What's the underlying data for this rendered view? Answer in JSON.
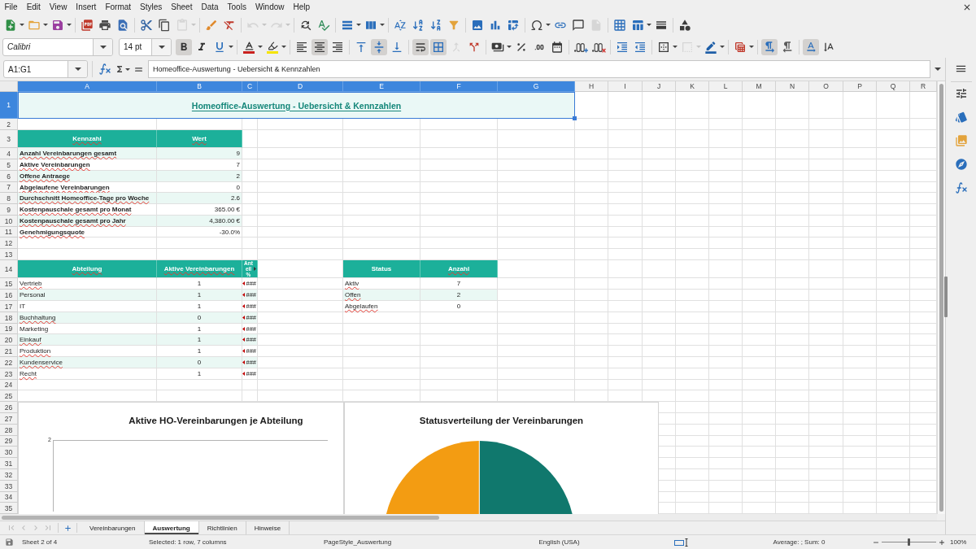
{
  "menu_bar": {
    "items": [
      "File",
      "Edit",
      "View",
      "Insert",
      "Format",
      "Styles",
      "Sheet",
      "Data",
      "Tools",
      "Window",
      "Help"
    ]
  },
  "standard_toolbar": {
    "groups": [
      [
        {
          "kind": "new",
          "menu": true,
          "disabled": false
        },
        {
          "kind": "open",
          "menu": true,
          "disabled": false
        },
        {
          "kind": "save",
          "menu": true,
          "disabled": false
        }
      ],
      [
        {
          "kind": "pdf",
          "menu": false,
          "disabled": false
        },
        {
          "kind": "print",
          "menu": false,
          "disabled": false
        },
        {
          "kind": "preview",
          "menu": false,
          "disabled": false
        }
      ],
      [
        {
          "kind": "cut",
          "menu": false,
          "disabled": false
        },
        {
          "kind": "copy",
          "menu": false,
          "disabled": false
        },
        {
          "kind": "paste",
          "menu": true,
          "disabled": true
        }
      ],
      [
        {
          "kind": "clone",
          "menu": false,
          "disabled": false
        },
        {
          "kind": "clear",
          "menu": false,
          "disabled": false
        }
      ],
      [
        {
          "kind": "undo",
          "menu": true,
          "disabled": true
        },
        {
          "kind": "redo",
          "menu": true,
          "disabled": true
        }
      ],
      [
        {
          "kind": "find",
          "menu": false,
          "disabled": false
        },
        {
          "kind": "spelling",
          "menu": false,
          "disabled": false
        }
      ],
      [
        {
          "kind": "row",
          "menu": true,
          "disabled": false
        },
        {
          "kind": "column",
          "menu": true,
          "disabled": false
        }
      ],
      [
        {
          "kind": "sort",
          "menu": false,
          "disabled": false
        },
        {
          "kind": "ascending",
          "menu": false,
          "disabled": false
        },
        {
          "kind": "descending",
          "menu": false,
          "disabled": false
        },
        {
          "kind": "autofilter",
          "menu": false,
          "disabled": false
        }
      ],
      [
        {
          "kind": "image",
          "menu": false,
          "disabled": false
        },
        {
          "kind": "chart",
          "menu": false,
          "disabled": false
        },
        {
          "kind": "pivot",
          "menu": false,
          "disabled": false
        }
      ],
      [
        {
          "kind": "special",
          "menu": true,
          "disabled": false
        },
        {
          "kind": "hyperlink",
          "menu": false,
          "disabled": false
        },
        {
          "kind": "comment",
          "menu": false,
          "disabled": false
        },
        {
          "kind": "headers",
          "menu": false,
          "disabled": true
        }
      ],
      [
        {
          "kind": "printarea",
          "menu": false,
          "disabled": false
        },
        {
          "kind": "freeze",
          "menu": true,
          "disabled": false
        },
        {
          "kind": "split",
          "menu": false,
          "disabled": false
        }
      ],
      [
        {
          "kind": "draw",
          "menu": false,
          "disabled": false
        }
      ]
    ]
  },
  "formatting_toolbar": {
    "font_name": "Calibri",
    "font_size": "14 pt",
    "groups": [
      [
        {
          "kind": "bold",
          "active": true,
          "menu": false,
          "disabled": false
        },
        {
          "kind": "italic",
          "active": false,
          "menu": false,
          "disabled": false
        },
        {
          "kind": "underline",
          "active": false,
          "menu": true,
          "disabled": false
        }
      ],
      [
        {
          "kind": "fontcolor",
          "active": false,
          "menu": true,
          "disabled": false
        },
        {
          "kind": "highlight",
          "active": false,
          "menu": true,
          "disabled": false
        }
      ],
      [
        {
          "kind": "alignleft",
          "active": false,
          "menu": false,
          "disabled": false
        },
        {
          "kind": "aligncenter",
          "active": true,
          "menu": false,
          "disabled": false
        },
        {
          "kind": "alignright",
          "active": false,
          "menu": false,
          "disabled": false
        }
      ],
      [
        {
          "kind": "aligntop",
          "active": false,
          "menu": false,
          "disabled": false
        },
        {
          "kind": "alignmiddle",
          "active": true,
          "menu": false,
          "disabled": false
        },
        {
          "kind": "alignbottom",
          "active": false,
          "menu": false,
          "disabled": false
        }
      ],
      [
        {
          "kind": "wrap",
          "active": true,
          "menu": false,
          "disabled": false
        },
        {
          "kind": "mergecenter",
          "active": true,
          "menu": false,
          "disabled": false
        },
        {
          "kind": "merge",
          "active": false,
          "menu": false,
          "disabled": true
        },
        {
          "kind": "unmerge",
          "active": false,
          "menu": false,
          "disabled": false
        }
      ],
      [
        {
          "kind": "currency",
          "active": false,
          "menu": true,
          "disabled": false
        },
        {
          "kind": "percent",
          "active": false,
          "menu": false,
          "disabled": false
        },
        {
          "kind": "number",
          "active": false,
          "menu": false,
          "disabled": false
        },
        {
          "kind": "date",
          "active": false,
          "menu": false,
          "disabled": false
        }
      ],
      [
        {
          "kind": "adddecimal",
          "active": false,
          "menu": false,
          "disabled": false
        },
        {
          "kind": "deletedecimal",
          "active": false,
          "menu": false,
          "disabled": false
        }
      ],
      [
        {
          "kind": "indent",
          "active": false,
          "menu": false,
          "disabled": false
        },
        {
          "kind": "outdent",
          "active": false,
          "menu": false,
          "disabled": false
        }
      ],
      [
        {
          "kind": "borders",
          "active": false,
          "menu": true,
          "disabled": false
        },
        {
          "kind": "borderstyle",
          "active": false,
          "menu": true,
          "disabled": true
        },
        {
          "kind": "bordercolor",
          "active": false,
          "menu": true,
          "disabled": false
        }
      ],
      [
        {
          "kind": "conditional",
          "active": false,
          "menu": true,
          "disabled": false
        }
      ],
      [
        {
          "kind": "ltr",
          "active": true,
          "menu": false,
          "disabled": false
        },
        {
          "kind": "rtl",
          "active": false,
          "menu": false,
          "disabled": false
        }
      ],
      [
        {
          "kind": "texthorizontal",
          "active": true,
          "menu": false,
          "disabled": false
        },
        {
          "kind": "textvertical",
          "active": false,
          "menu": false,
          "disabled": false
        }
      ]
    ]
  },
  "formula_bar": {
    "name_box": "A1:G1",
    "content": "Homeoffice-Auswertung - Uebersicht & Kennzahlen"
  },
  "sheet": {
    "columns": [
      {
        "label": "A",
        "selected": true
      },
      {
        "label": "B",
        "selected": true
      },
      {
        "label": "C",
        "selected": true
      },
      {
        "label": "D",
        "selected": true
      },
      {
        "label": "E",
        "selected": true
      },
      {
        "label": "F",
        "selected": true
      },
      {
        "label": "G",
        "selected": true
      },
      {
        "label": "H",
        "selected": false
      },
      {
        "label": "I",
        "selected": false
      },
      {
        "label": "J",
        "selected": false
      },
      {
        "label": "K",
        "selected": false
      },
      {
        "label": "L",
        "selected": false
      },
      {
        "label": "M",
        "selected": false
      },
      {
        "label": "N",
        "selected": false
      },
      {
        "label": "O",
        "selected": false
      },
      {
        "label": "P",
        "selected": false
      },
      {
        "label": "Q",
        "selected": false
      },
      {
        "label": "R",
        "selected": false
      }
    ],
    "rows": [
      {
        "label": "1",
        "selected": true
      },
      {
        "label": "2",
        "selected": false
      },
      {
        "label": "3",
        "selected": false
      },
      {
        "label": "4",
        "selected": false
      },
      {
        "label": "5",
        "selected": false
      },
      {
        "label": "6",
        "selected": false
      },
      {
        "label": "7",
        "selected": false
      },
      {
        "label": "8",
        "selected": false
      },
      {
        "label": "9",
        "selected": false
      },
      {
        "label": "10",
        "selected": false
      },
      {
        "label": "11",
        "selected": false
      },
      {
        "label": "12",
        "selected": false
      },
      {
        "label": "13",
        "selected": false
      },
      {
        "label": "14",
        "selected": false
      },
      {
        "label": "15",
        "selected": false
      },
      {
        "label": "16",
        "selected": false
      },
      {
        "label": "17",
        "selected": false
      },
      {
        "label": "18",
        "selected": false
      },
      {
        "label": "19",
        "selected": false
      },
      {
        "label": "20",
        "selected": false
      },
      {
        "label": "21",
        "selected": false
      },
      {
        "label": "22",
        "selected": false
      },
      {
        "label": "23",
        "selected": false
      },
      {
        "label": "24",
        "selected": false
      },
      {
        "label": "25",
        "selected": false
      },
      {
        "label": "26",
        "selected": false
      },
      {
        "label": "27",
        "selected": false
      },
      {
        "label": "28",
        "selected": false
      },
      {
        "label": "29",
        "selected": false
      },
      {
        "label": "30",
        "selected": false
      },
      {
        "label": "31",
        "selected": false
      },
      {
        "label": "32",
        "selected": false
      },
      {
        "label": "33",
        "selected": false
      },
      {
        "label": "34",
        "selected": false
      },
      {
        "label": "35",
        "selected": false
      }
    ],
    "title": {
      "text": "Homeoffice-Auswertung - Uebersicht & Kennzahlen",
      "selected": true
    },
    "kpi_table": {
      "headers": [
        {
          "text": "Kennzahl",
          "misspelled": true
        },
        {
          "text": "Wert",
          "misspelled": true
        }
      ],
      "rows": [
        {
          "label": "Anzahl Vereinbarungen gesamt",
          "misspelled": true,
          "value": "9"
        },
        {
          "label": "Aktive Vereinbarungen",
          "misspelled": true,
          "value": "7"
        },
        {
          "label": "Offene Antraege",
          "misspelled": true,
          "value": "2"
        },
        {
          "label": "Abgelaufene Vereinbarungen",
          "misspelled": true,
          "value": "0"
        },
        {
          "label": "Durchschnitt Homeoffice-Tage pro Woche",
          "misspelled": true,
          "value": "2.6"
        },
        {
          "label": "Kostenpauschale gesamt pro Monat",
          "misspelled": true,
          "value": "365.00 €"
        },
        {
          "label": "Kostenpauschale gesamt pro Jahr",
          "misspelled": true,
          "value": "4,380.00 €"
        },
        {
          "label": "Genehmigungsquote",
          "misspelled": true,
          "value": "-30.0%"
        }
      ]
    },
    "department_table": {
      "headers": [
        {
          "text": "Abteilung",
          "misspelled": true
        },
        {
          "text": "Aktive Vereinbarungen",
          "misspelled": true
        },
        {
          "text": "Anteil %",
          "misspelled": false
        }
      ],
      "rows": [
        {
          "name": "Vertrieb",
          "misspelled": true,
          "active": "1",
          "share": "###"
        },
        {
          "name": "Personal",
          "misspelled": false,
          "active": "1",
          "share": "###"
        },
        {
          "name": "IT",
          "misspelled": false,
          "active": "1",
          "share": "###"
        },
        {
          "name": "Buchhaltung",
          "misspelled": true,
          "active": "0",
          "share": "###"
        },
        {
          "name": "Marketing",
          "misspelled": false,
          "active": "1",
          "share": "###"
        },
        {
          "name": "Einkauf",
          "misspelled": true,
          "active": "1",
          "share": "###"
        },
        {
          "name": "Produktion",
          "misspelled": true,
          "active": "1",
          "share": "###"
        },
        {
          "name": "Kundenservice",
          "misspelled": true,
          "active": "0",
          "share": "###"
        },
        {
          "name": "Recht",
          "misspelled": true,
          "active": "1",
          "share": "###"
        }
      ]
    },
    "status_table": {
      "headers": [
        {
          "text": "Status",
          "misspelled": false
        },
        {
          "text": "Anzahl",
          "misspelled": true
        }
      ],
      "rows": [
        {
          "status": "Aktiv",
          "misspelled": true,
          "count": "7"
        },
        {
          "status": "Offen",
          "misspelled": true,
          "count": "2"
        },
        {
          "status": "Abgelaufen",
          "misspelled": true,
          "count": "0"
        }
      ]
    },
    "charts": [
      {
        "kind": "bar",
        "title": "Aktive HO-Vereinbarungen je Abteilung",
        "y_tick_labels": [
          "2"
        ]
      },
      {
        "kind": "pie",
        "title": "Statusverteilung der Vereinbarungen"
      }
    ]
  },
  "sheet_tabs": {
    "navigation": [
      {
        "kind": "first",
        "disabled": true
      },
      {
        "kind": "previous",
        "disabled": true
      },
      {
        "kind": "next",
        "disabled": true
      },
      {
        "kind": "last",
        "disabled": true
      }
    ],
    "tabs": [
      {
        "label": "Vereinbarungen",
        "selected": false
      },
      {
        "label": "Auswertung",
        "selected": true
      },
      {
        "label": "Richtlinien",
        "selected": false
      },
      {
        "label": "Hinweise",
        "selected": false
      }
    ]
  },
  "status_bar": {
    "sheet": "Sheet 2 of 4",
    "selection": "Selected: 1 row, 7 columns",
    "page_style": "PageStyle_Auswertung",
    "language": "English (USA)",
    "summary": "Average: ; Sum: 0",
    "zoom_slider": {
      "level": 0.5
    },
    "zoom": "100%"
  }
}
